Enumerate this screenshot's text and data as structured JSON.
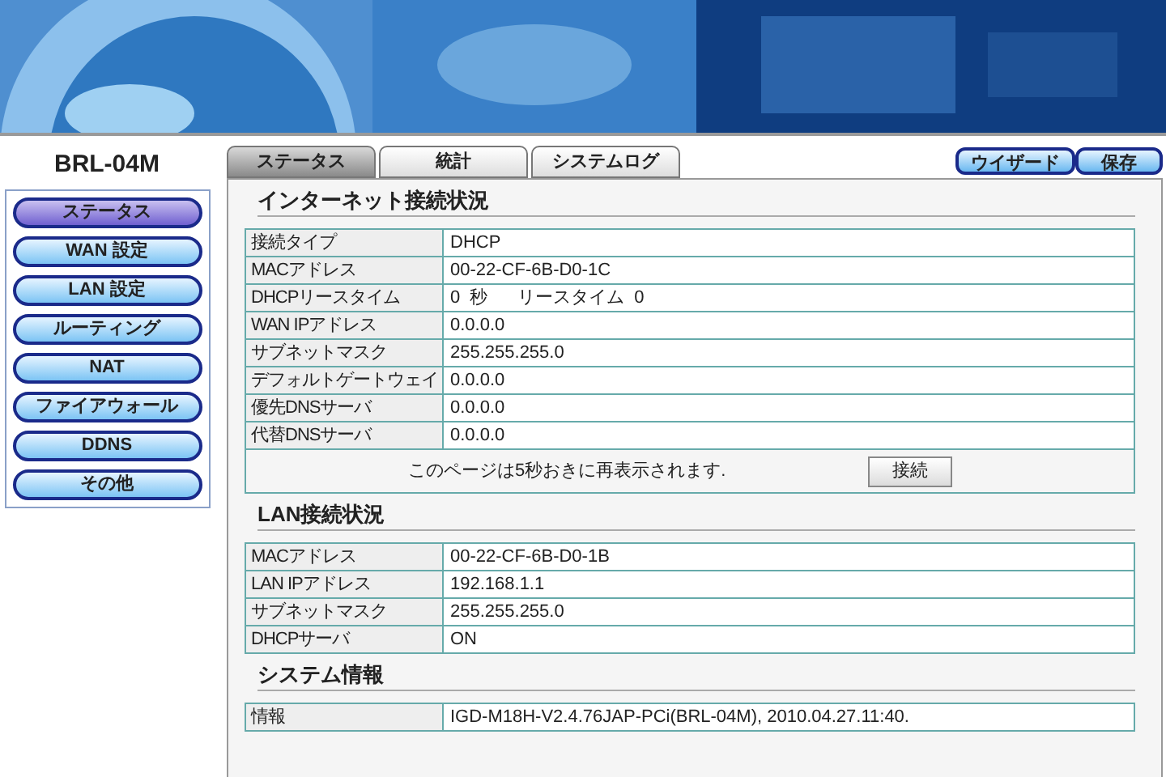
{
  "brand": "BRL-04M",
  "sidebar": {
    "items": [
      {
        "label": "ステータス",
        "selected": true
      },
      {
        "label": "WAN 設定",
        "selected": false
      },
      {
        "label": "LAN 設定",
        "selected": false
      },
      {
        "label": "ルーティング",
        "selected": false
      },
      {
        "label": "NAT",
        "selected": false
      },
      {
        "label": "ファイアウォール",
        "selected": false
      },
      {
        "label": "DDNS",
        "selected": false
      },
      {
        "label": "その他",
        "selected": false
      }
    ]
  },
  "tabs": [
    {
      "label": "ステータス",
      "selected": true
    },
    {
      "label": "統計",
      "selected": false
    },
    {
      "label": "システムログ",
      "selected": false
    }
  ],
  "actions": [
    "ウイザード",
    "保存"
  ],
  "sections": [
    {
      "title": "インターネット接続状況",
      "rows": [
        [
          "接続タイプ",
          "DHCP"
        ],
        [
          "MACアドレス",
          "00-22-CF-6B-D0-1C"
        ],
        [
          "DHCPリースタイム",
          "0  秒      リースタイム  0"
        ],
        [
          "WAN IPアドレス",
          "0.0.0.0"
        ],
        [
          "サブネットマスク",
          "255.255.255.0"
        ],
        [
          "デフォルトゲートウェイ",
          "0.0.0.0"
        ],
        [
          "優先DNSサーバ",
          "0.0.0.0"
        ],
        [
          "代替DNSサーバ",
          "0.0.0.0"
        ]
      ],
      "note": "このページは5秒おきに再表示されます.",
      "button": "接続"
    },
    {
      "title": "LAN接続状況",
      "rows": [
        [
          "MACアドレス",
          "00-22-CF-6B-D0-1B"
        ],
        [
          "LAN IPアドレス",
          "192.168.1.1"
        ],
        [
          "サブネットマスク",
          "255.255.255.0"
        ],
        [
          "DHCPサーバ",
          "ON"
        ]
      ]
    },
    {
      "title": "システム情報",
      "rows": [
        [
          "情報",
          "IGD-M18H-V2.4.76JAP-PCi(BRL-04M), 2010.04.27.11:40."
        ]
      ]
    }
  ]
}
